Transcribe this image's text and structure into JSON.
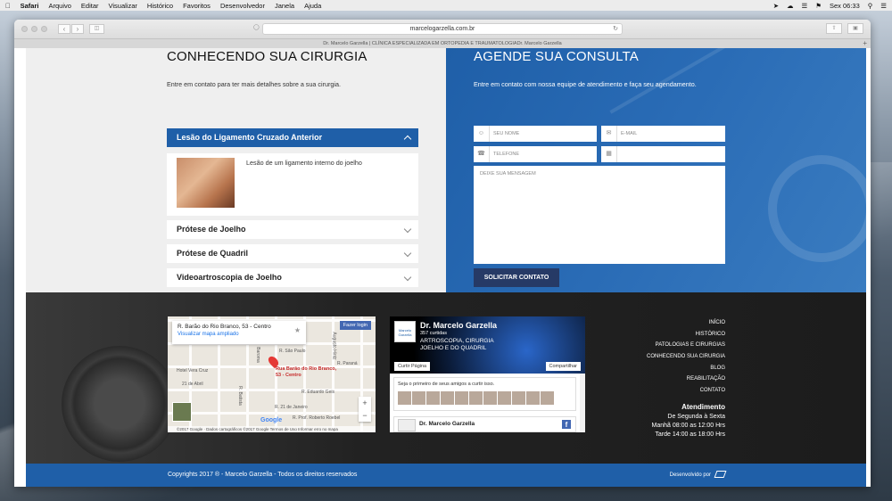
{
  "menubar": {
    "apple_icon": "apple-icon",
    "app": "Safari",
    "items": [
      "Arquivo",
      "Editar",
      "Visualizar",
      "Histórico",
      "Favoritos",
      "Desenvolvedor",
      "Janela",
      "Ajuda"
    ],
    "clock": "Sex 06:33"
  },
  "browser": {
    "url": "marcelogarzella.com.br",
    "tab_title": "Dr. Marcelo Garzella | CLÍNICA ESPECIALIZADA EM ORTOPEDIA E TRAUMATOLOGIADr. Marcelo Garzella"
  },
  "surgery": {
    "title": "CONHECENDO SUA CIRURGIA",
    "subtitle": "Entre em contato para ter mais detalhes sobre a sua cirurgia.",
    "items": [
      {
        "label": "Lesão do Ligamento Cruzado Anterior",
        "text": "Lesão de um ligamento interno do joelho"
      },
      {
        "label": "Prótese de Joelho"
      },
      {
        "label": "Prótese de Quadril"
      },
      {
        "label": "Videoartroscopia de Joelho"
      }
    ]
  },
  "contact": {
    "title": "AGENDE SUA CONSULTA",
    "subtitle": "Entre em contato com nossa equipe de atendimento e faça seu agendamento.",
    "name_placeholder": "SEU NOME",
    "email_placeholder": "E-MAIL",
    "phone_placeholder": "TELEFONE",
    "message_placeholder": "DEIXE SUA MENSAGEM",
    "submit": "SOLICITAR CONTATO"
  },
  "map": {
    "address": "R. Barão do Rio Branco, 53 - Centro",
    "link": "Visualizar mapa ampliado",
    "login": "Fazer login",
    "pin_label": "Rua Barão do Rio Branco, 53 - Centro",
    "streets": [
      "Hotel Vera Cruz",
      "R. São Paulo",
      "R. Paraná",
      "21 de Abril",
      "R. Eduardo Geis",
      "R. 21 de Janeiro",
      "R. Prof. Roberto Roebel",
      "Augusto Hintz",
      "R. Batista",
      "Baroma"
    ],
    "google": "Google",
    "copyright": "©2017 Google · Dados cartográficos ©2017 Google    Termos de Uso    Informar erro no mapa"
  },
  "facebook": {
    "logo_text": "Marcelo Garzella",
    "name": "Dr. Marcelo Garzella",
    "likes": "357 curtidas",
    "desc": "ARTROSCOPIA, CIRURGIA JOELHO E DO QUADRIL",
    "like_btn": "Curtir Página",
    "share_btn": "Compartilhar",
    "friends_text": "Seja o primeiro de seus amigos a curtir isso.",
    "post_name": "Dr. Marcelo Garzella"
  },
  "footer_links": [
    "INÍCIO",
    "HISTÓRICO",
    "PATOLOGIAS E CIRURGIAS",
    "CONHECENDO SUA CIRURGIA",
    "BLOG",
    "REABILITAÇÃO",
    "CONTATO"
  ],
  "hours": {
    "title": "Atendimento",
    "days": "De Segunda à Sexta",
    "morning": "Manhã 08:00 as 12:00 Hrs",
    "afternoon": "Tarde 14:00 as 18:00 Hrs"
  },
  "copyright": "Copyrights 2017 ® - Marcelo Garzella - Todos os direitos reservados",
  "developed_by": "Desenvolvido por",
  "colors": {
    "primary": "#1f5fa8",
    "dark": "#263a66",
    "footer": "#1c1c1c"
  }
}
